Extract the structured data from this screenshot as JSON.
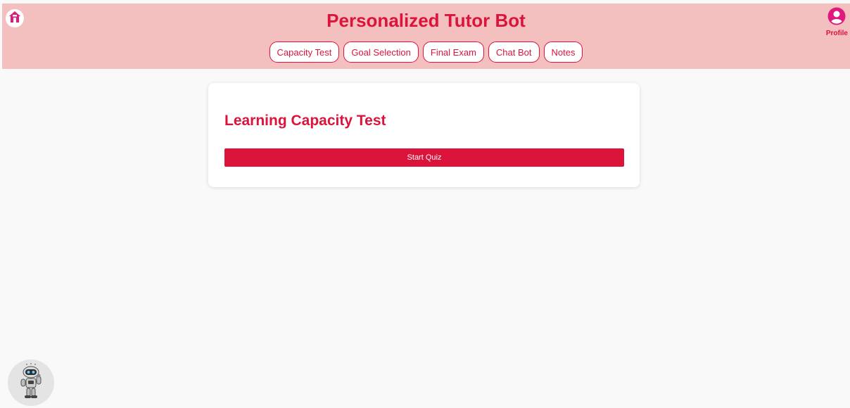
{
  "app": {
    "title": "Personalized Tutor Bot"
  },
  "header": {
    "home_icon": "home-icon",
    "profile_label": "Profile",
    "profile_icon": "user-circle-icon"
  },
  "nav": {
    "items": [
      {
        "label": "Capacity Test"
      },
      {
        "label": "Goal Selection"
      },
      {
        "label": "Final Exam"
      },
      {
        "label": "Chat Bot"
      },
      {
        "label": "Notes"
      }
    ]
  },
  "main": {
    "card_title": "Learning Capacity Test",
    "start_button": "Start Quiz"
  },
  "chatbot": {
    "icon": "robot-icon"
  },
  "colors": {
    "accent": "#dc143c",
    "header_bg": "#f4bfbf",
    "page_bg": "#f9f9f9",
    "icon_pink": "#e0197d"
  }
}
